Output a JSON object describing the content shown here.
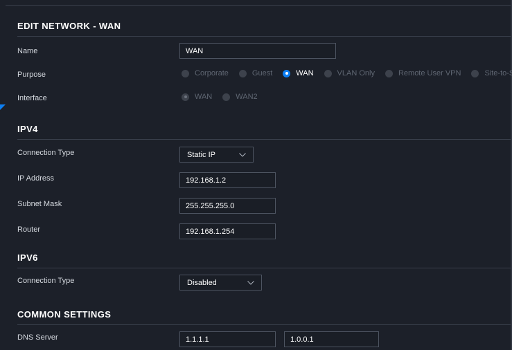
{
  "edit_network": {
    "title": "EDIT NETWORK - WAN",
    "name_label": "Name",
    "name_value": "WAN",
    "purpose_label": "Purpose",
    "purpose_options": [
      {
        "label": "Corporate",
        "selected": false
      },
      {
        "label": "Guest",
        "selected": false
      },
      {
        "label": "WAN",
        "selected": true
      },
      {
        "label": "VLAN Only",
        "selected": false
      },
      {
        "label": "Remote User VPN",
        "selected": false
      },
      {
        "label": "Site-to-Site",
        "selected": false
      }
    ],
    "interface_label": "Interface",
    "interface_options": [
      {
        "label": "WAN",
        "selected": true
      },
      {
        "label": "WAN2",
        "selected": false
      }
    ]
  },
  "ipv4": {
    "title": "IPV4",
    "connection_type_label": "Connection Type",
    "connection_type_value": "Static IP",
    "ip_address_label": "IP Address",
    "ip_address_value": "192.168.1.2",
    "subnet_mask_label": "Subnet Mask",
    "subnet_mask_value": "255.255.255.0",
    "router_label": "Router",
    "router_value": "192.168.1.254"
  },
  "ipv6": {
    "title": "IPV6",
    "connection_type_label": "Connection Type",
    "connection_type_value": "Disabled"
  },
  "common": {
    "title": "COMMON SETTINGS",
    "dns_label": "DNS Server",
    "dns_primary": "1.1.1.1",
    "dns_secondary": "1.0.0.1"
  },
  "colors": {
    "background": "#1c2029",
    "accent": "#0d7ef2",
    "input_border": "#4d5461",
    "disabled_text": "#5f6672"
  },
  "icons": {
    "select_arrow": "chevron-down-icon",
    "radio": "radio-icon"
  }
}
